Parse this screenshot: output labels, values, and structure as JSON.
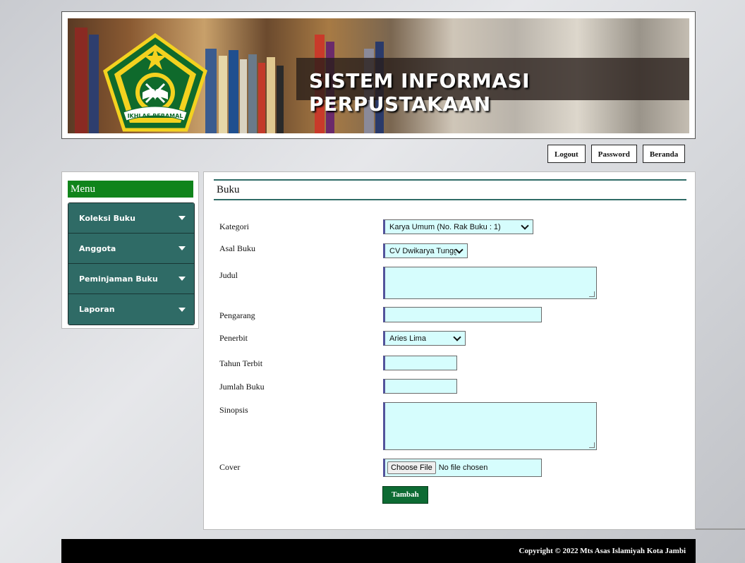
{
  "header": {
    "title": "SISTEM INFORMASI PERPUSTAKAAN",
    "logo_text": "IKHLAS BERAMAL"
  },
  "topnav": [
    {
      "label": "Logout"
    },
    {
      "label": "Password"
    },
    {
      "label": "Beranda"
    }
  ],
  "sidebar": {
    "title": "Menu",
    "items": [
      {
        "label": "Koleksi Buku"
      },
      {
        "label": "Anggota"
      },
      {
        "label": "Peminjaman Buku"
      },
      {
        "label": "Laporan"
      }
    ]
  },
  "form": {
    "title": "Buku",
    "labels": {
      "kategori": "Kategori",
      "asal_buku": "Asal Buku",
      "judul": "Judul",
      "pengarang": "Pengarang",
      "penerbit": "Penerbit",
      "tahun_terbit": "Tahun Terbit",
      "jumlah_buku": "Jumlah Buku",
      "sinopsis": "Sinopsis",
      "cover": "Cover"
    },
    "values": {
      "kategori": "Karya Umum (No. Rak Buku : 1)",
      "asal_buku": "CV Dwikarya Tungg",
      "judul": "",
      "pengarang": "",
      "penerbit": "Aries Lima",
      "tahun_terbit": "",
      "jumlah_buku": "",
      "sinopsis": ""
    },
    "file": {
      "button": "Choose File",
      "status": "No file chosen"
    },
    "submit": "Tambah"
  },
  "footer": {
    "copyright": "Copyright © 2022 Mts Asas Islamiyah Kota Jambi"
  },
  "colors": {
    "menu_green": "#10841b",
    "menu_teal": "#2f6b66",
    "field_bg": "#d6fdfd",
    "submit_green": "#0d6b33"
  }
}
